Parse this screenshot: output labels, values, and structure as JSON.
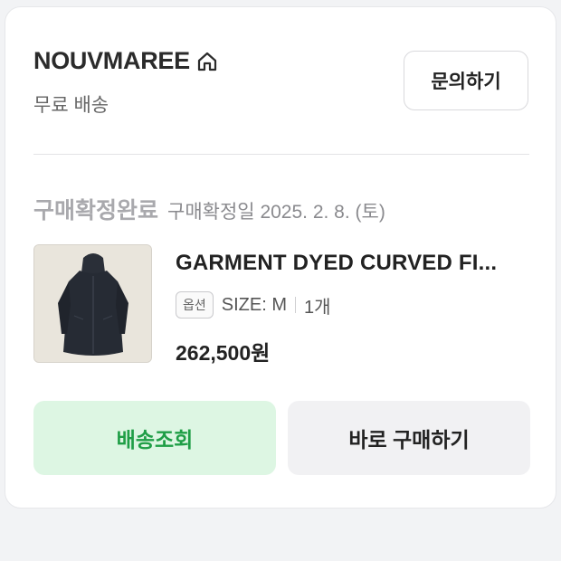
{
  "shop": {
    "name": "NOUVMAREE",
    "home_icon": "home-icon",
    "shipping": "무료 배송"
  },
  "inquiry_button": {
    "label": "문의하기"
  },
  "order": {
    "status": "구매확정완료",
    "date": "구매확정일 2025. 2. 8. (토)"
  },
  "product": {
    "title": "GARMENT DYED CURVED FI...",
    "option_badge": "옵션",
    "option_value": "SIZE: M",
    "quantity": "1개",
    "price": "262,500원"
  },
  "actions": {
    "track_label": "배송조회",
    "buy_again_label": "바로 구매하기"
  },
  "colors": {
    "accent_green": "#1f9e46",
    "accent_green_bg": "#ddf6e3"
  }
}
